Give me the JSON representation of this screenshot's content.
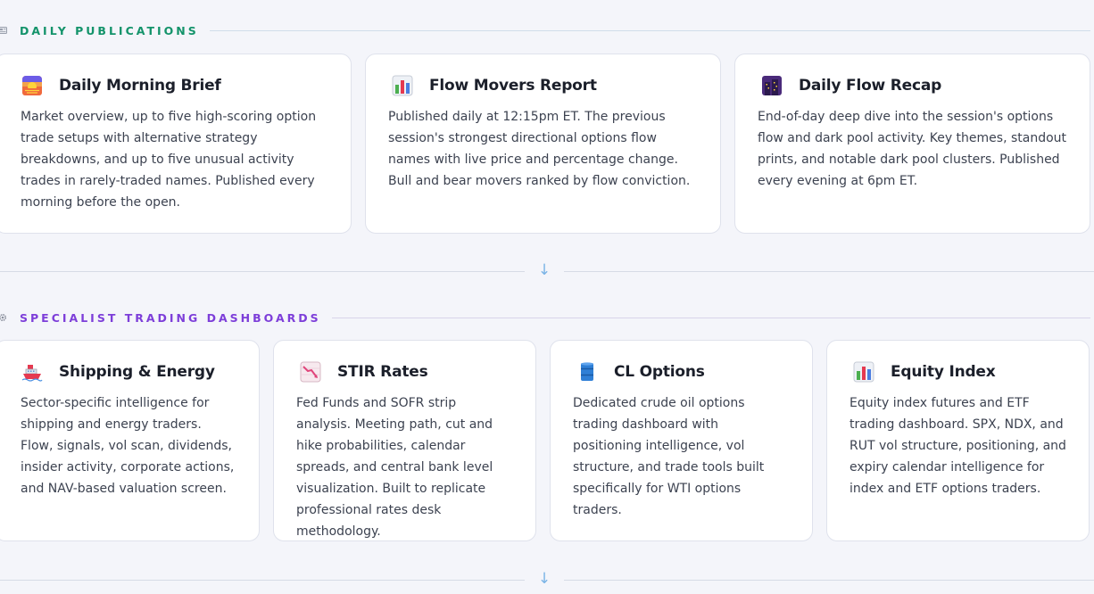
{
  "sections": [
    {
      "title": "DAILY PUBLICATIONS",
      "icon": "newspaper-icon",
      "accent": "#13936a",
      "cards": [
        {
          "icon": "sunrise-icon",
          "title": "Daily Morning Brief",
          "description": "Market overview, up to five high-scoring option trade setups with alternative strategy breakdowns, and up to five unusual activity trades in rarely-traded names. Published every morning before the open."
        },
        {
          "icon": "bar-chart-icon",
          "title": "Flow Movers Report",
          "description": "Published daily at 12:15pm ET. The previous session's strongest directional options flow names with live price and percentage change. Bull and bear movers ranked by flow conviction."
        },
        {
          "icon": "night-city-icon",
          "title": "Daily Flow Recap",
          "description": "End-of-day deep dive into the session's options flow and dark pool activity. Key themes, standout prints, and notable dark pool clusters. Published every evening at 6pm ET."
        }
      ]
    },
    {
      "title": "SPECIALIST TRADING DASHBOARDS",
      "icon": "gear-icon",
      "accent": "#7d3ed9",
      "cards": [
        {
          "icon": "ship-icon",
          "title": "Shipping & Energy",
          "description": "Sector-specific intelligence for shipping and energy traders. Flow, signals, vol scan, dividends, insider activity, corporate actions, and NAV-based valuation screen."
        },
        {
          "icon": "chart-decreasing-icon",
          "title": "STIR Rates",
          "description": "Fed Funds and SOFR strip analysis. Meeting path, cut and hike probabilities, calendar spreads, and central bank level visualization. Built to replicate professional rates desk methodology."
        },
        {
          "icon": "oil-drum-icon",
          "title": "CL Options",
          "description": "Dedicated crude oil options trading dashboard with positioning intelligence, vol structure, and trade tools built specifically for WTI options traders."
        },
        {
          "icon": "bar-chart-icon",
          "title": "Equity Index",
          "description": "Equity index futures and ETF trading dashboard. SPX, NDX, and RUT vol structure, positioning, and expiry calendar intelligence for index and ETF options traders."
        }
      ]
    }
  ],
  "divider_arrow": "↓"
}
